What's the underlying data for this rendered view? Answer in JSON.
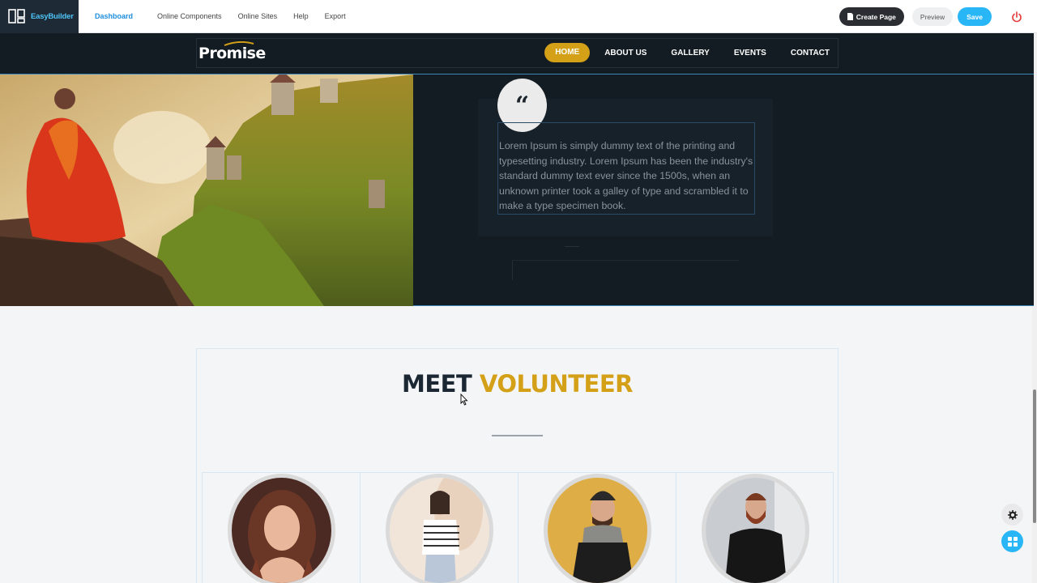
{
  "builder": {
    "brand_name": "EasyBuilder",
    "nav": [
      "Dashboard",
      "Online Components",
      "Online Sites",
      "Help",
      "Export"
    ],
    "create_page_label": "Create Page",
    "preview_label": "Preview",
    "save_label": "Save",
    "logo_icon": "easybuilder-logo-icon",
    "power_icon": "power-icon"
  },
  "site": {
    "logo_text": "Promise",
    "nav": [
      "HOME",
      "ABOUT US",
      "GALLERY",
      "EVENTS",
      "CONTACT"
    ],
    "active_nav": "HOME"
  },
  "hero": {
    "quote_icon": "“",
    "quote_text": "Lorem Ipsum is simply dummy text of the printing and typesetting industry. Lorem Ipsum has been the industry's standard dummy text ever since the 1500s, when an unknown printer took a galley of type and scrambled it to make a type specimen book."
  },
  "volunteers": {
    "title_part1": "MEET",
    "title_part2": "VOLUNTEER",
    "cards": [
      "volunteer-1",
      "volunteer-2",
      "volunteer-3",
      "volunteer-4"
    ]
  },
  "colors": {
    "accent_gold": "#d4a017",
    "builder_blue": "#29b6f6",
    "dark_bg": "#131c22"
  },
  "floating": {
    "settings_icon": "gear-icon",
    "blocks_icon": "grid-icon"
  }
}
